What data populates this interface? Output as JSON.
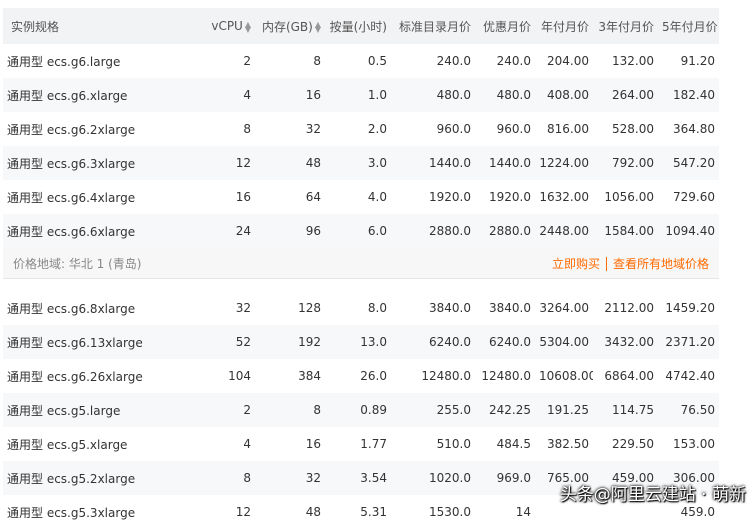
{
  "table": {
    "headers": [
      "实例规格",
      "vCPU",
      "内存(GB)",
      "按量(小时)",
      "标准目录月价",
      "优惠月价",
      "年付月价",
      "3年付月价",
      "5年付月价"
    ],
    "rows_top": [
      [
        "通用型 ecs.g6.large",
        "2",
        "8",
        "0.5",
        "240.0",
        "240.0",
        "204.00",
        "132.00",
        "91.20"
      ],
      [
        "通用型 ecs.g6.xlarge",
        "4",
        "16",
        "1.0",
        "480.0",
        "480.0",
        "408.00",
        "264.00",
        "182.40"
      ],
      [
        "通用型 ecs.g6.2xlarge",
        "8",
        "32",
        "2.0",
        "960.0",
        "960.0",
        "816.00",
        "528.00",
        "364.80"
      ],
      [
        "通用型 ecs.g6.3xlarge",
        "12",
        "48",
        "3.0",
        "1440.0",
        "1440.0",
        "1224.00",
        "792.00",
        "547.20"
      ],
      [
        "通用型 ecs.g6.4xlarge",
        "16",
        "64",
        "4.0",
        "1920.0",
        "1920.0",
        "1632.00",
        "1056.00",
        "729.60"
      ],
      [
        "通用型 ecs.g6.6xlarge",
        "24",
        "96",
        "6.0",
        "2880.0",
        "2880.0",
        "2448.00",
        "1584.00",
        "1094.40"
      ]
    ],
    "rows_bottom": [
      [
        "通用型 ecs.g6.8xlarge",
        "32",
        "128",
        "8.0",
        "3840.0",
        "3840.0",
        "3264.00",
        "2112.00",
        "1459.20"
      ],
      [
        "通用型 ecs.g6.13xlarge",
        "52",
        "192",
        "13.0",
        "6240.0",
        "6240.0",
        "5304.00",
        "3432.00",
        "2371.20"
      ],
      [
        "通用型 ecs.g6.26xlarge",
        "104",
        "384",
        "26.0",
        "12480.0",
        "12480.0",
        "10608.00",
        "6864.00",
        "4742.40"
      ],
      [
        "通用型 ecs.g5.large",
        "2",
        "8",
        "0.89",
        "255.0",
        "242.25",
        "191.25",
        "114.75",
        "76.50"
      ],
      [
        "通用型 ecs.g5.xlarge",
        "4",
        "16",
        "1.77",
        "510.0",
        "484.5",
        "382.50",
        "229.50",
        "153.00"
      ],
      [
        "通用型 ecs.g5.2xlarge",
        "8",
        "32",
        "3.54",
        "1020.0",
        "969.0",
        "765.00",
        "459.00",
        "306.00"
      ],
      [
        "通用型 ecs.g5.3xlarge",
        "12",
        "48",
        "5.31",
        "1530.0",
        "14",
        "",
        "",
        "459.0"
      ]
    ]
  },
  "info_row": {
    "region": "价格地域: 华北 1 (青岛)",
    "buy_link": "立即购买",
    "all_regions_link": "查看所有地域价格"
  },
  "watermark": "头条@阿里云建站 · 萌新",
  "colors": {
    "accent": "#ff6a00",
    "header_bg": "#f2f3f5",
    "alt_row_bg": "#f7f8fa"
  }
}
